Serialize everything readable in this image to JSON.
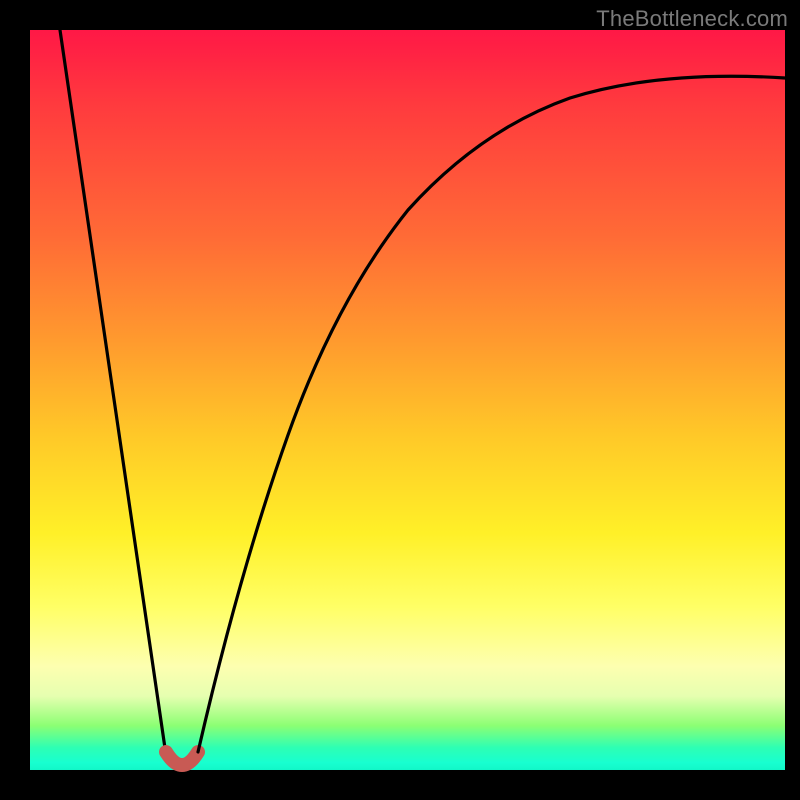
{
  "watermark": "TheBottleneck.com",
  "chart_data": {
    "type": "line",
    "title": "",
    "xlabel": "",
    "ylabel": "",
    "xlim": [
      0,
      100
    ],
    "ylim": [
      0,
      100
    ],
    "grid": false,
    "legend": false,
    "series": [
      {
        "name": "left-slope",
        "x": [
          4,
          18
        ],
        "y": [
          100,
          2
        ]
      },
      {
        "name": "valley-marker",
        "x": [
          18,
          19.5,
          21,
          22.5
        ],
        "y": [
          2,
          0.8,
          0.8,
          2.2
        ],
        "stroke": "#c85a54",
        "stroke_width": 14,
        "linecap": "round"
      },
      {
        "name": "right-curve",
        "x": [
          22.5,
          28,
          34,
          40,
          46,
          52,
          58,
          64,
          72,
          80,
          88,
          96,
          100
        ],
        "y": [
          2.2,
          26,
          45,
          58,
          67,
          73.5,
          78.5,
          82.5,
          86.5,
          89.5,
          91.5,
          93,
          93.5
        ]
      }
    ],
    "annotations": []
  }
}
